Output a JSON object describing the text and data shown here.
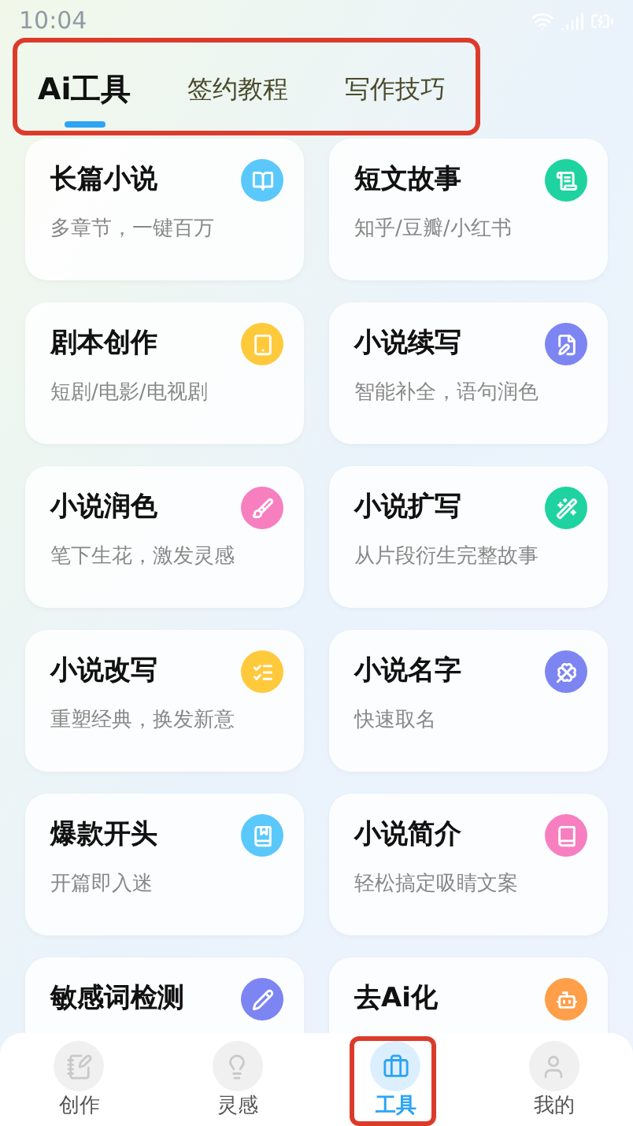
{
  "status_bar": {
    "time": "10:04"
  },
  "tabs": [
    {
      "label": "Ai工具",
      "selected": true
    },
    {
      "label": "签约教程",
      "selected": false
    },
    {
      "label": "写作技巧",
      "selected": false
    }
  ],
  "tools": [
    {
      "title": "长篇小说",
      "subtitle": "多章节，一键百万",
      "color": "#5ac8fa"
    },
    {
      "title": "短文故事",
      "subtitle": "知乎/豆瓣/小红书",
      "color": "#1ed39f"
    },
    {
      "title": "剧本创作",
      "subtitle": "短剧/电影/电视剧",
      "color": "#ffc93c"
    },
    {
      "title": "小说续写",
      "subtitle": "智能补全，语句润色",
      "color": "#7c85f2"
    },
    {
      "title": "小说润色",
      "subtitle": "笔下生花，激发灵感",
      "color": "#f77fc0"
    },
    {
      "title": "小说扩写",
      "subtitle": "从片段衍生完整故事",
      "color": "#1ed39f"
    },
    {
      "title": "小说改写",
      "subtitle": "重塑经典，换发新意",
      "color": "#ffc93c"
    },
    {
      "title": "小说名字",
      "subtitle": "快速取名",
      "color": "#7c85f2"
    },
    {
      "title": "爆款开头",
      "subtitle": "开篇即入迷",
      "color": "#5ac8fa"
    },
    {
      "title": "小说简介",
      "subtitle": "轻松搞定吸睛文案",
      "color": "#f77fc0"
    },
    {
      "title": "敏感词检测",
      "color": "#7c85f2"
    },
    {
      "title": "去Ai化",
      "color": "#ff9f4a"
    }
  ],
  "bottom_nav": [
    {
      "label": "创作",
      "selected": false
    },
    {
      "label": "灵感",
      "selected": false
    },
    {
      "label": "工具",
      "selected": true
    },
    {
      "label": "我的",
      "selected": false
    }
  ]
}
